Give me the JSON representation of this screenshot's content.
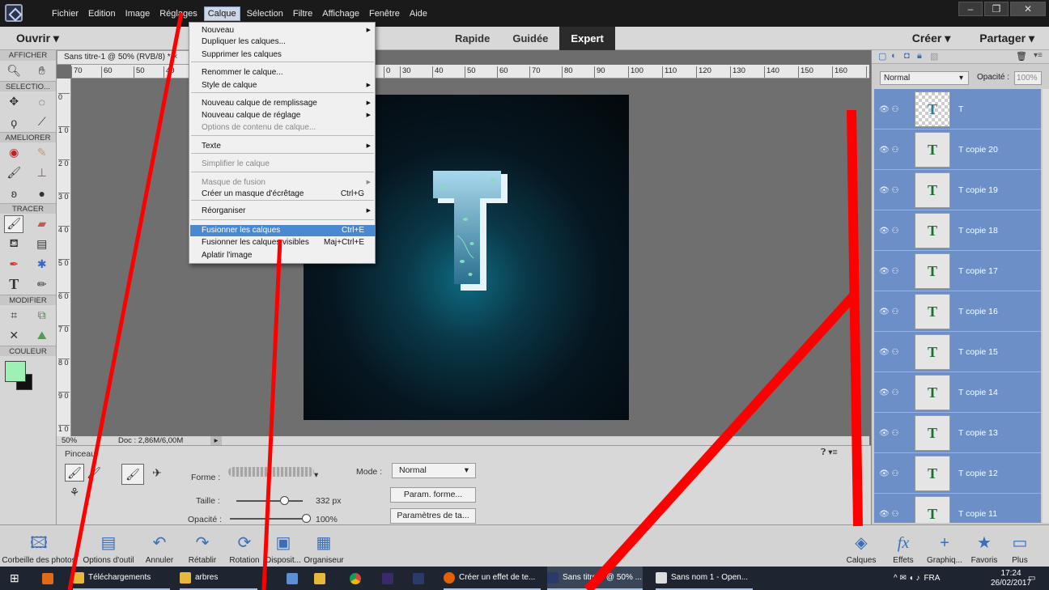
{
  "menubar": {
    "items": [
      "Fichier",
      "Edition",
      "Image",
      "Réglages",
      "Calque",
      "Sélection",
      "Filtre",
      "Affichage",
      "Fenêtre",
      "Aide"
    ],
    "window_controls": [
      "–",
      "❐",
      "✕"
    ]
  },
  "modebar": {
    "open_label": "Ouvrir",
    "modes": [
      "Rapide",
      "Guidée",
      "Expert"
    ],
    "create_label": "Créer",
    "share_label": "Partager"
  },
  "toolbox": {
    "sections": [
      "AFFICHER",
      "SELECTIO...",
      "AMELIORER",
      "TRACER",
      "MODIFIER",
      "COULEUR"
    ]
  },
  "document": {
    "tab_title": "Sans titre-1 @ 50% (RVB/8) *",
    "tab_close": "×",
    "ruler_top": [
      "70",
      "60",
      "50",
      "40",
      "0",
      "30",
      "40",
      "50",
      "60",
      "70",
      "80",
      "90",
      "100",
      "110",
      "120",
      "130",
      "140",
      "150",
      "160",
      "1"
    ],
    "ruler_left": [
      "0",
      "1 0",
      "2 0",
      "3 0",
      "4 0",
      "5 0",
      "6 0",
      "7 0",
      "8 0",
      "9 0",
      "1 0"
    ],
    "zoom": "50%",
    "doc_size": "Doc : 2,86M/6,00M",
    "letter_colors": {
      "face_top": "#a9d8ec",
      "face_bottom": "#2b6f8f",
      "extrude": "#e6f3f9"
    }
  },
  "calque_menu": {
    "items": [
      {
        "label": "Nouveau",
        "arrow": true
      },
      {
        "label": "Dupliquer les calques..."
      },
      {
        "label": "Supprimer les calques"
      },
      {
        "label": "Renommer le calque..."
      },
      {
        "label": "Style de calque",
        "arrow": true
      },
      {
        "label": "Nouveau calque de remplissage",
        "arrow": true
      },
      {
        "label": "Nouveau calque de réglage",
        "arrow": true
      },
      {
        "label": "Options de contenu de calque...",
        "disabled": true
      },
      {
        "label": "Texte",
        "arrow": true
      },
      {
        "label": "Simplifier le calque",
        "disabled": true
      },
      {
        "label": "Masque de fusion",
        "arrow": true,
        "disabled": true
      },
      {
        "label": "Créer un masque d'écrêtage",
        "shortcut": "Ctrl+G"
      },
      {
        "label": "Réorganiser",
        "arrow": true
      },
      {
        "label": "Fusionner les calques",
        "shortcut": "Ctrl+E",
        "highlighted": true
      },
      {
        "label": "Fusionner les calques visibles",
        "shortcut": "Maj+Ctrl+E"
      },
      {
        "label": "Aplatir l'image"
      }
    ]
  },
  "tool_options": {
    "tool_name": "Pinceau",
    "forme_label": "Forme :",
    "mode_label": "Mode :",
    "mode_value": "Normal",
    "taille_label": "Taille :",
    "taille_value": "332 px",
    "opacite_label": "Opacité :",
    "opacite_value": "100%",
    "taille_fraction": 0.72,
    "opacite_fraction": 1.0,
    "btn_param_forme": "Param. forme...",
    "btn_param_tablette": "Paramètres de ta..."
  },
  "layers_panel": {
    "blend_mode": "Normal",
    "opacity_label": "Opacité :",
    "opacity_value": "100%",
    "layers": [
      {
        "name": "T",
        "thumb": "T",
        "raster": true
      },
      {
        "name": "T copie 20",
        "thumb": "T"
      },
      {
        "name": "T copie 19",
        "thumb": "T"
      },
      {
        "name": "T copie 18",
        "thumb": "T"
      },
      {
        "name": "T copie 17",
        "thumb": "T"
      },
      {
        "name": "T copie 16",
        "thumb": "T"
      },
      {
        "name": "T copie 15",
        "thumb": "T"
      },
      {
        "name": "T copie 14",
        "thumb": "T"
      },
      {
        "name": "T copie 13",
        "thumb": "T"
      },
      {
        "name": "T copie 12",
        "thumb": "T"
      },
      {
        "name": "T copie 11",
        "thumb": "T"
      }
    ]
  },
  "bottombar": {
    "left": [
      "Corbeille des photos",
      "Options d'outil",
      "Annuler",
      "Rétablir",
      "Rotation",
      "Disposit...",
      "Organiseur"
    ],
    "right": [
      "Calques",
      "Effets",
      "Graphiq...",
      "Favoris",
      "Plus"
    ]
  },
  "taskbar": {
    "items": [
      "Téléchargements",
      "arbres",
      "Créer un effet de te...",
      "Sans titre-1 @ 50% ...",
      "Sans nom 1 - Open..."
    ],
    "lang": "FRA",
    "time": "17:24",
    "date": "26/02/2017"
  },
  "colors": {
    "accent_red": "#ff0000",
    "menu_highlight": "#4a88d2",
    "layer_row": "#6b8fc6",
    "foreground_color": "#9ef0b4"
  }
}
